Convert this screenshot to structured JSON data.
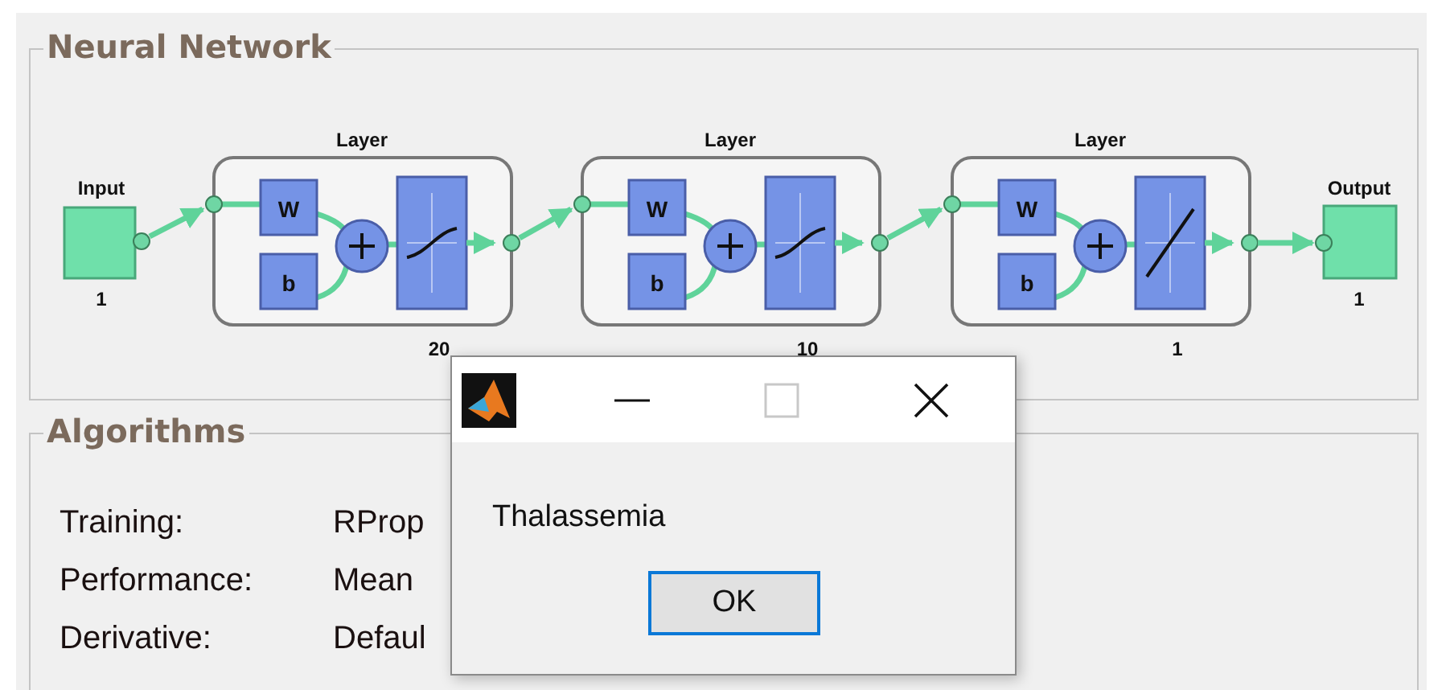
{
  "neural_network": {
    "title": "Neural Network",
    "input": {
      "label": "Input",
      "size": "1"
    },
    "layers": [
      {
        "title": "Layer",
        "weight": "W",
        "bias": "b",
        "size": "20",
        "kind": "tansig"
      },
      {
        "title": "Layer",
        "weight": "W",
        "bias": "b",
        "size": "10",
        "kind": "tansig"
      },
      {
        "title": "Layer",
        "weight": "W",
        "bias": "b",
        "size": "1",
        "kind": "purelin"
      }
    ],
    "output": {
      "label": "Output",
      "size": "1"
    }
  },
  "algorithms": {
    "title": "Algorithms",
    "rows": [
      {
        "label": "Training:",
        "value": "RProp"
      },
      {
        "label": "Performance:",
        "value": "Mean"
      },
      {
        "label": "Derivative:",
        "value": "Defaul"
      }
    ]
  },
  "dialog": {
    "maximize_disabled": true,
    "message": "Thalassemia",
    "button": "OK"
  }
}
